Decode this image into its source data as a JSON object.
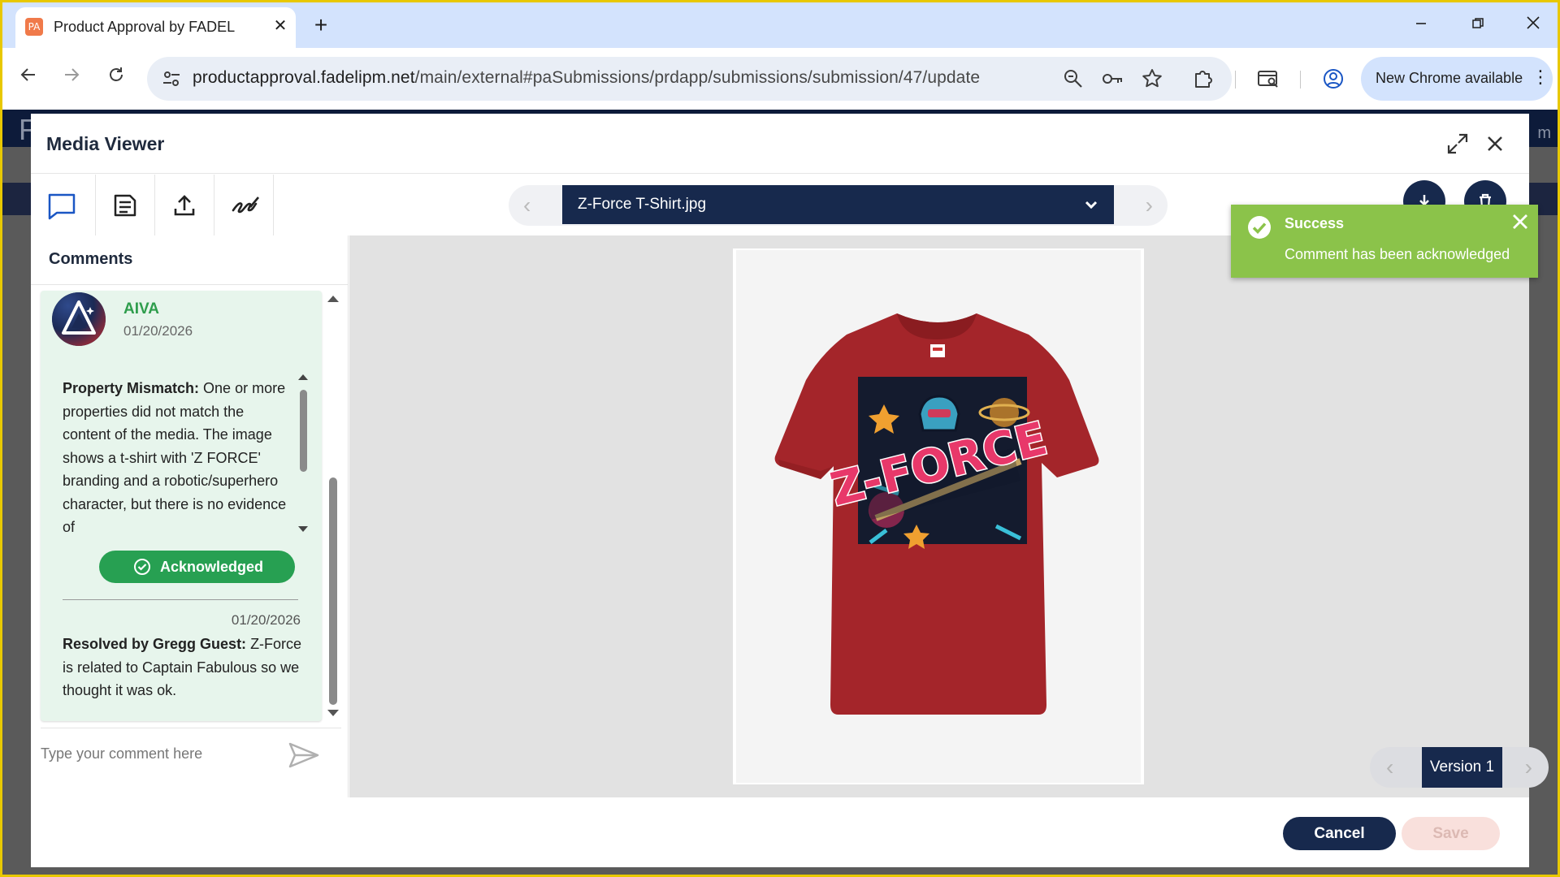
{
  "browser": {
    "tab_title": "Product Approval by FADEL",
    "tab_favicon_text": "PA",
    "url_host": "productapproval.fadelipm.net",
    "url_path": "/main/external#paSubmissions/prdapp/submissions/submission/47/update",
    "update_label": "New Chrome available"
  },
  "page_behind": {
    "logo_letter": "F",
    "right_text": "m"
  },
  "dialog": {
    "title": "Media Viewer",
    "file_name": "Z-Force T-Shirt.jpg",
    "version_label": "Version 1",
    "cancel_label": "Cancel",
    "save_label": "Save"
  },
  "comments": {
    "title": "Comments",
    "author": "AIVA",
    "date": "01/20/2026",
    "body_bold": "Property Mismatch:",
    "body_text": " One or more properties did not match the content of the media. The image shows a t-shirt with 'Z FORCE' branding and a robotic/superhero character, but there is no evidence of",
    "ack_label": "Acknowledged",
    "resolution_date": "01/20/2026",
    "resolution_bold": "Resolved by Gregg Guest:",
    "resolution_text": " Z-Force is related to Captain Fabulous so we thought it was ok.",
    "input_placeholder": "Type your comment here"
  },
  "artwork_text": "Z-FORCE",
  "toast": {
    "title": "Success",
    "message": "Comment has been acknowledged",
    "color": "#8bc34a"
  },
  "colors": {
    "navy": "#17294d",
    "green": "#27a052",
    "author_green": "#2e9d4c"
  }
}
